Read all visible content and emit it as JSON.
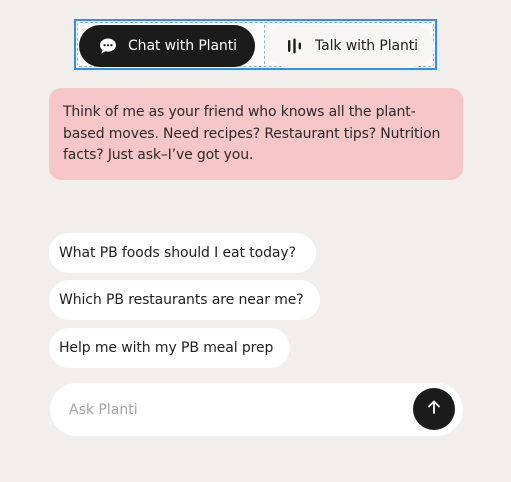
{
  "toggle": {
    "chat_label": "Chat with Planti",
    "talk_label": "Talk with Planti",
    "chat_icon": "chat-bubble-icon",
    "talk_icon": "audio-bars-icon",
    "selected": "chat"
  },
  "intro": {
    "text": "Think of me as your friend who knows all the plant-based moves. Need recipes? Restaurant tips? Nutrition facts? Just ask–I’ve got you."
  },
  "suggestions": [
    {
      "label": "What PB foods should I eat today?"
    },
    {
      "label": "Which PB restaurants are near me?"
    },
    {
      "label": "Help me with my PB meal prep"
    }
  ],
  "input": {
    "placeholder": "Ask Planti",
    "value": "",
    "send_icon": "arrow-up-icon"
  },
  "colors": {
    "background": "#f1eeeb",
    "intro_bubble": "#f7c6c9",
    "active_toggle": "#1b1b1b",
    "selection_outline": "#2d8ff0"
  }
}
